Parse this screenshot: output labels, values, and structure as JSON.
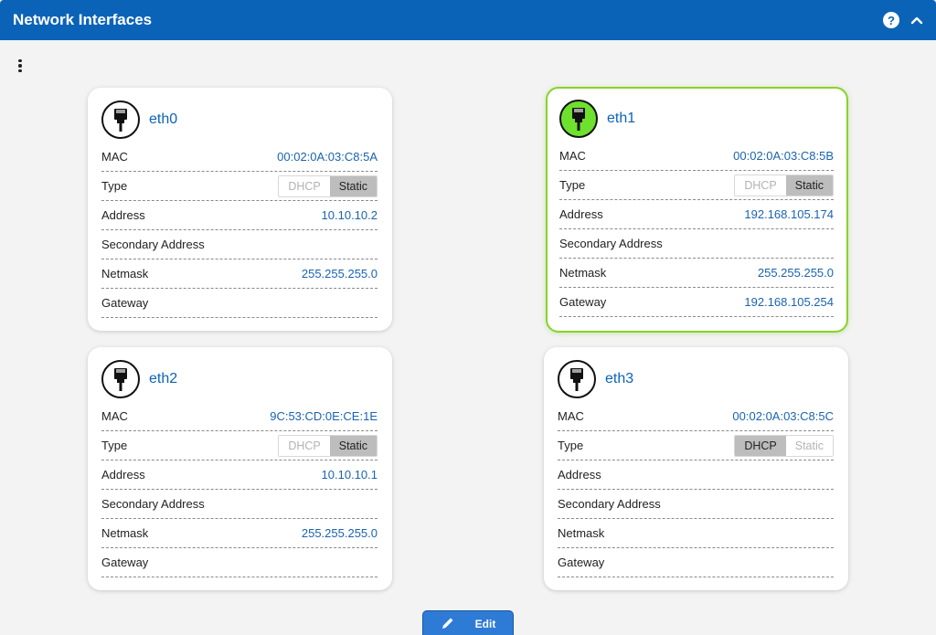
{
  "header": {
    "title": "Network Interfaces",
    "help_icon": "help-circle-icon",
    "help_glyph": "?",
    "collapse_icon": "chevron-up-icon"
  },
  "colors": {
    "header_bg": "#0b63b8",
    "link_blue": "#1a63b0",
    "active_border": "#8ad12d",
    "active_icon": "#6ee02e",
    "selected_toggle": "#bdbdbd",
    "edit_button": "#2e7bd6"
  },
  "labels": {
    "mac": "MAC",
    "type": "Type",
    "address": "Address",
    "secondary_address": "Secondary Address",
    "netmask": "Netmask",
    "gateway": "Gateway",
    "dhcp": "DHCP",
    "static": "Static"
  },
  "interfaces": [
    {
      "name": "eth0",
      "icon": "ethernet-port-icon",
      "link_up": false,
      "mac": "00:02:0A:03:C8:5A",
      "type": "Static",
      "address": "10.10.10.2",
      "secondary_address": "",
      "netmask": "255.255.255.0",
      "gateway": ""
    },
    {
      "name": "eth1",
      "icon": "ethernet-port-icon",
      "link_up": true,
      "mac": "00:02:0A:03:C8:5B",
      "type": "Static",
      "address": "192.168.105.174",
      "secondary_address": "",
      "netmask": "255.255.255.0",
      "gateway": "192.168.105.254"
    },
    {
      "name": "eth2",
      "icon": "ethernet-port-icon",
      "link_up": false,
      "mac": "9C:53:CD:0E:CE:1E",
      "type": "Static",
      "address": "10.10.10.1",
      "secondary_address": "",
      "netmask": "255.255.255.0",
      "gateway": ""
    },
    {
      "name": "eth3",
      "icon": "ethernet-port-icon",
      "link_up": false,
      "mac": "00:02:0A:03:C8:5C",
      "type": "DHCP",
      "address": "",
      "secondary_address": "",
      "netmask": "",
      "gateway": ""
    }
  ],
  "menu_icon": "more-vertical-icon",
  "edit_button": {
    "label": "Edit",
    "icon": "pencil-icon"
  }
}
